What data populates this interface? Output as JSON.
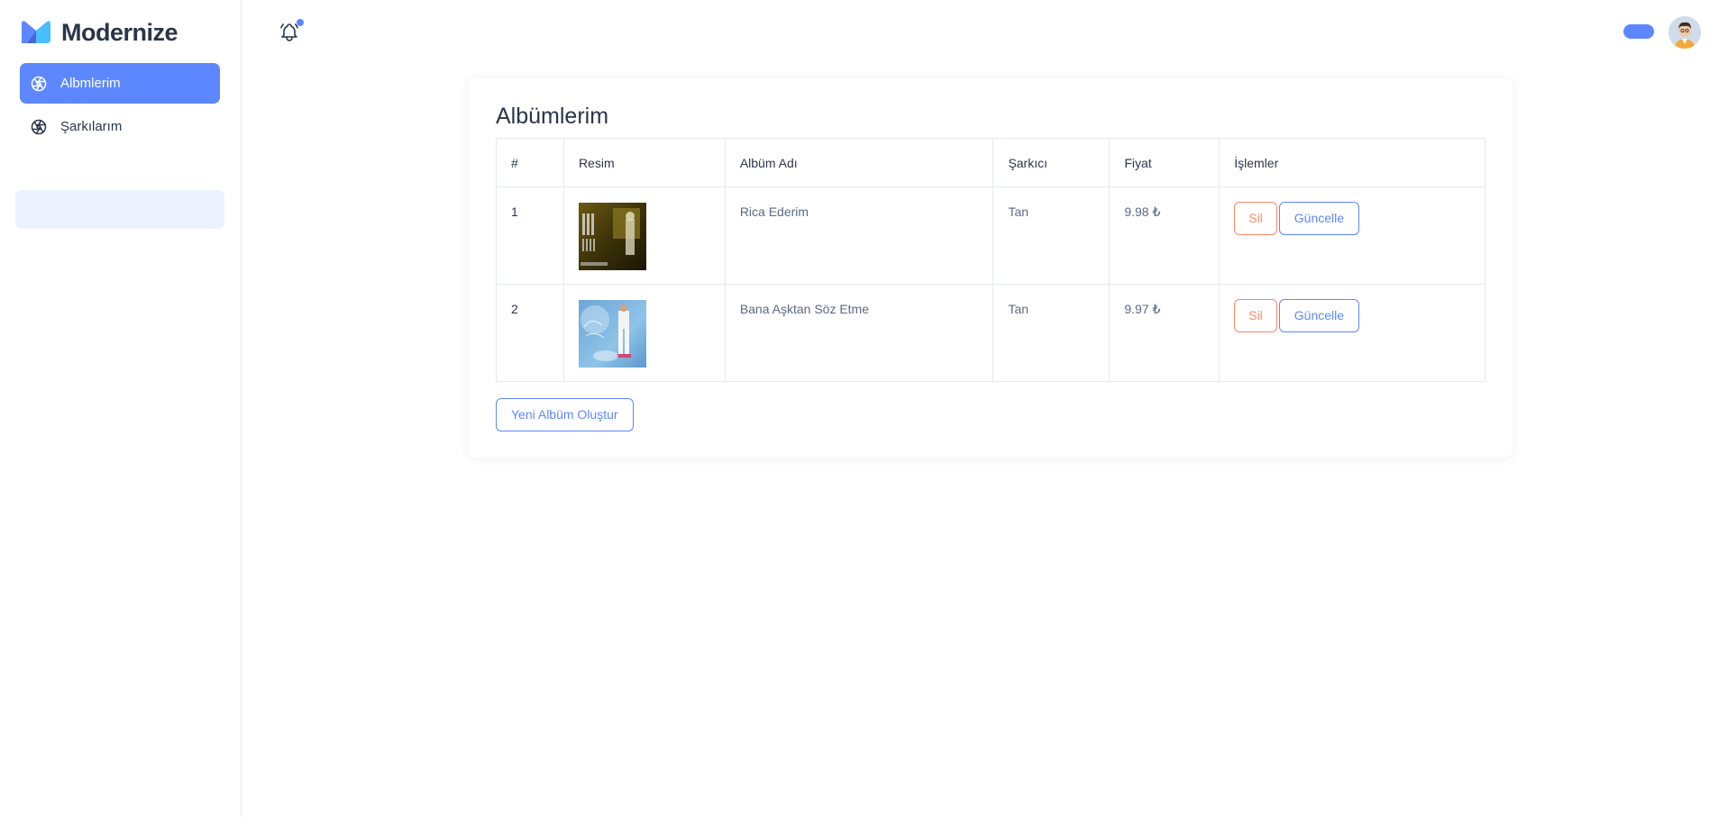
{
  "brand": {
    "name": "Modernize"
  },
  "sidebar": {
    "items": [
      {
        "label": "Albmlerim",
        "icon": "aperture-icon",
        "active": true
      },
      {
        "label": "Şarkılarım",
        "icon": "aperture-icon",
        "active": false
      }
    ]
  },
  "header": {
    "notification_icon": "bell-icon"
  },
  "card": {
    "title": "Albümlerim",
    "columns": [
      "#",
      "Resim",
      "Albüm Adı",
      "Şarkıcı",
      "Fiyat",
      "İşlemler"
    ],
    "rows": [
      {
        "index": "1",
        "cover": "album-cover-1",
        "name": "Rica Ederim",
        "artist": "Tan",
        "price": "9.98 ₺",
        "delete_label": "Sil",
        "update_label": "Güncelle"
      },
      {
        "index": "2",
        "cover": "album-cover-2",
        "name": "Bana Aşktan Söz Etme",
        "artist": "Tan",
        "price": "9.97 ₺",
        "delete_label": "Sil",
        "update_label": "Güncelle"
      }
    ],
    "new_button": "Yeni Albüm Oluştur"
  },
  "colors": {
    "primary": "#5d87ff",
    "danger": "#fa896b",
    "light_primary": "#ecf2ff"
  }
}
